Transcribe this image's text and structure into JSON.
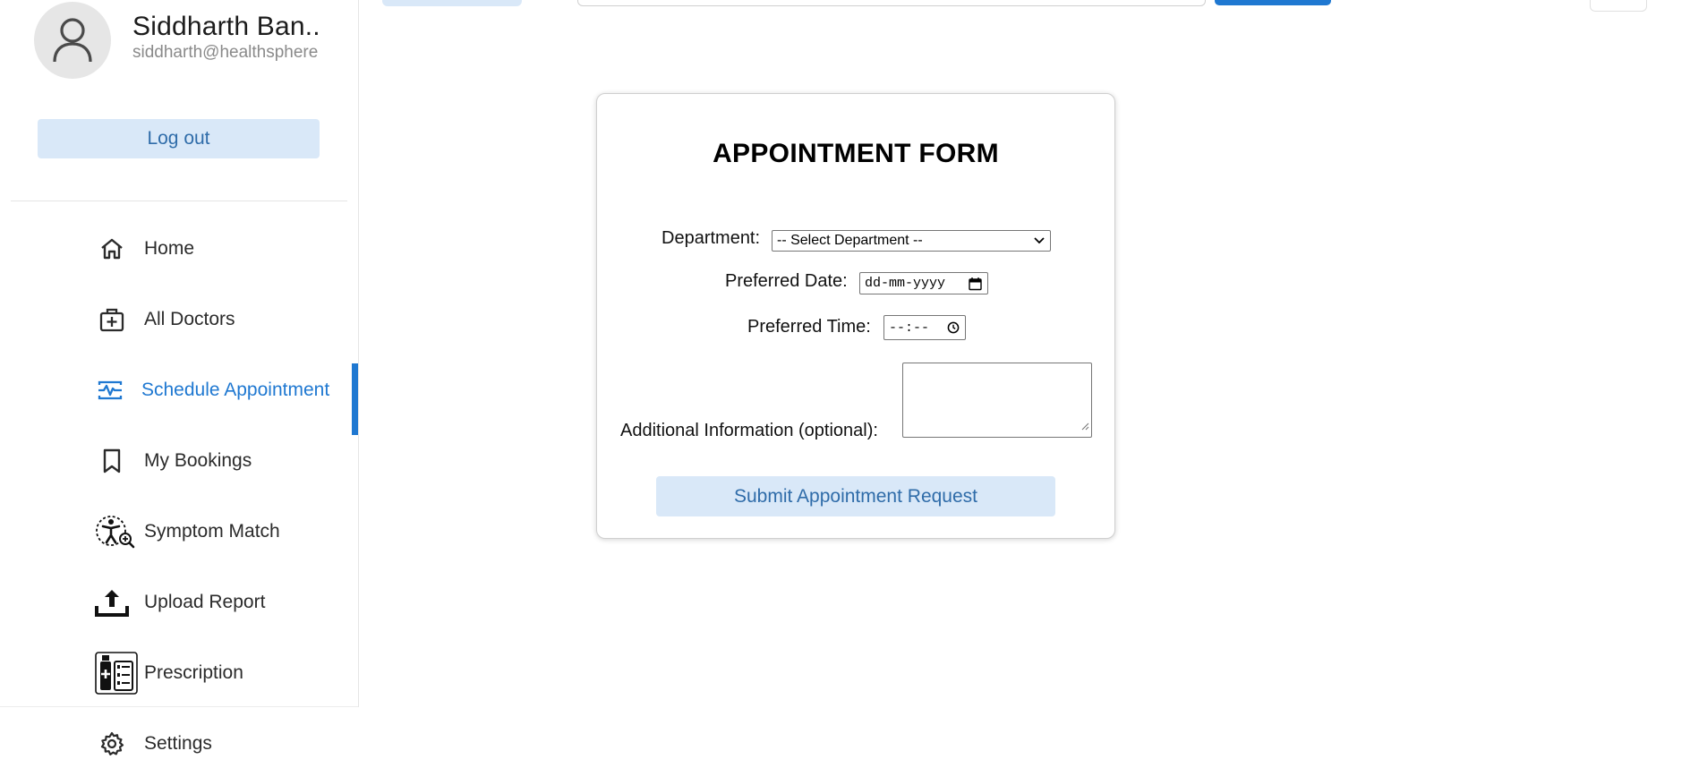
{
  "user": {
    "name": "Siddharth Ban..",
    "email": "siddharth@healthsphere",
    "logout_label": "Log out"
  },
  "sidebar": {
    "active_color": "#1f78d1",
    "items": [
      {
        "label": "Home",
        "icon": "home-icon"
      },
      {
        "label": "All Doctors",
        "icon": "medical-kit-icon"
      },
      {
        "label": "Schedule Appointment",
        "icon": "schedule-pulse-icon",
        "active": true
      },
      {
        "label": "My Bookings",
        "icon": "bookmark-icon"
      },
      {
        "label": "Symptom Match",
        "icon": "symptom-search-icon"
      },
      {
        "label": "Upload Report",
        "icon": "upload-icon"
      },
      {
        "label": "Prescription",
        "icon": "prescription-icon"
      },
      {
        "label": "Settings",
        "icon": "gear-icon"
      }
    ]
  },
  "form": {
    "title": "APPOINTMENT FORM",
    "department_label": "Department:",
    "department_value": "-- Select Department --",
    "date_label": "Preferred Date:",
    "date_placeholder": "dd-mm-yyyy",
    "time_label": "Preferred Time:",
    "time_placeholder": "--:--",
    "info_label": "Additional Information (optional):",
    "submit_label": "Submit Appointment Request"
  },
  "colors": {
    "accent": "#1f78d1",
    "button_bg": "#d9e8f8",
    "button_text": "#2f6ca9"
  }
}
